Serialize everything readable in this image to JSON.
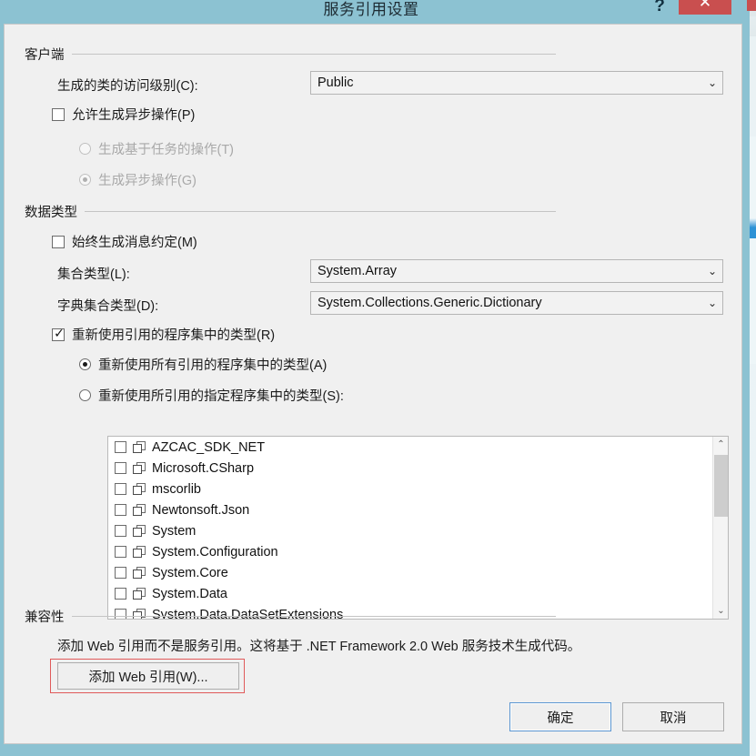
{
  "window": {
    "title": "服务引用设置",
    "help_icon": "?",
    "close_icon": "✕",
    "titlebar_color": "#8cc2d2",
    "close_button_color": "#c94f4f"
  },
  "groups": {
    "client": {
      "label": "客户端"
    },
    "datatype": {
      "label": "数据类型"
    },
    "compat": {
      "label": "兼容性"
    }
  },
  "client": {
    "access_level_label": "生成的类的访问级别(C):",
    "access_level_value": "Public",
    "access_level_chevron": "⌄",
    "allow_async_label": "允许生成异步操作(P)",
    "allow_async_checked": false,
    "task_based_label": "生成基于任务的操作(T)",
    "task_based_selected": false,
    "async_label": "生成异步操作(G)",
    "async_selected": true
  },
  "datatype": {
    "always_message_contract_label": "始终生成消息约定(M)",
    "always_message_contract_checked": false,
    "collection_type_label": "集合类型(L):",
    "collection_type_value": "System.Array",
    "dictionary_type_label": "字典集合类型(D):",
    "dictionary_type_value": "System.Collections.Generic.Dictionary",
    "reuse_types_label": "重新使用引用的程序集中的类型(R)",
    "reuse_types_checked": true,
    "reuse_all_label": "重新使用所有引用的程序集中的类型(A)",
    "reuse_all_selected": true,
    "reuse_specified_label": "重新使用所引用的指定程序集中的类型(S):",
    "reuse_specified_selected": false,
    "chevron": "⌄",
    "assemblies": [
      {
        "name": "AZCAC_SDK_NET",
        "checked": false
      },
      {
        "name": "Microsoft.CSharp",
        "checked": false
      },
      {
        "name": "mscorlib",
        "checked": false
      },
      {
        "name": "Newtonsoft.Json",
        "checked": false
      },
      {
        "name": "System",
        "checked": false
      },
      {
        "name": "System.Configuration",
        "checked": false
      },
      {
        "name": "System.Core",
        "checked": false
      },
      {
        "name": "System.Data",
        "checked": false
      },
      {
        "name": "System.Data.DataSetExtensions",
        "checked": false
      }
    ],
    "scroll_up_icon": "⌃",
    "scroll_down_icon": "⌄"
  },
  "compat": {
    "description": "添加 Web 引用而不是服务引用。这将基于 .NET Framework 2.0 Web 服务技术生成代码。",
    "add_web_ref_button": "添加 Web 引用(W)...",
    "highlight_color": "#e05a5a"
  },
  "footer": {
    "ok_label": "确定",
    "cancel_label": "取消"
  }
}
